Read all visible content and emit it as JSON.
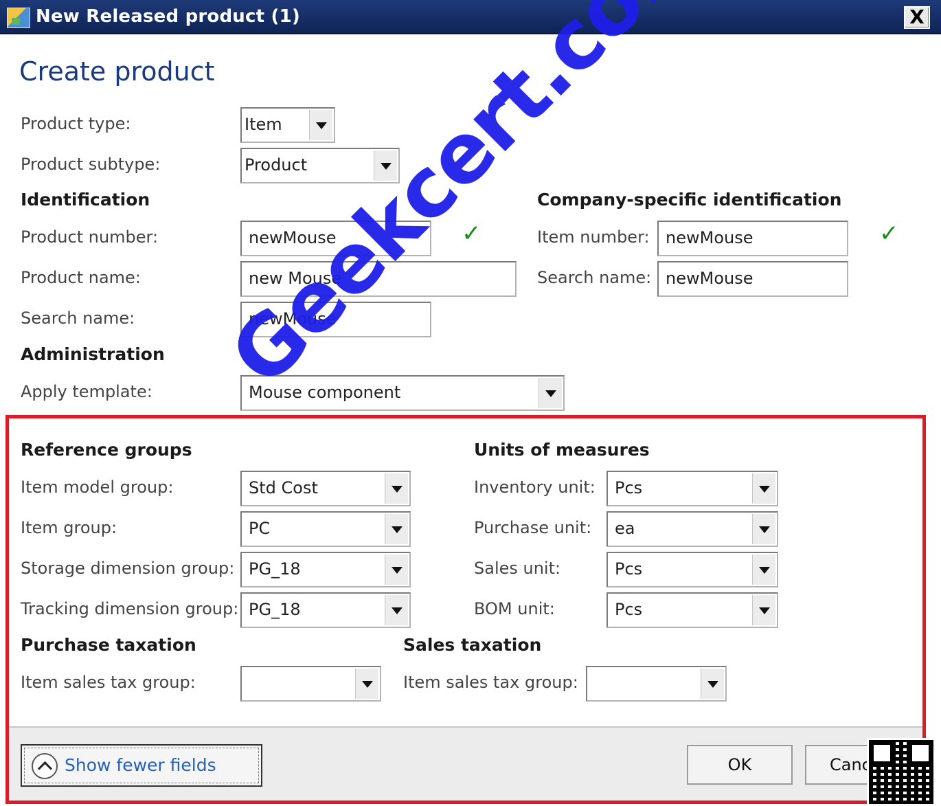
{
  "window": {
    "title": "New Released product (1)",
    "close_label": "X"
  },
  "heading": "Create product",
  "top": {
    "product_type_label": "Product type:",
    "product_type_value": "Item",
    "product_subtype_label": "Product subtype:",
    "product_subtype_value": "Product"
  },
  "identification": {
    "title": "Identification",
    "product_number_label": "Product number:",
    "product_number_value": "newMouse",
    "product_name_label": "Product name:",
    "product_name_value": "new Mouse",
    "search_name_label": "Search name:",
    "search_name_value": "newMouse"
  },
  "company": {
    "title": "Company-specific identification",
    "item_number_label": "Item number:",
    "item_number_value": "newMouse",
    "search_name_label": "Search name:",
    "search_name_value": "newMouse"
  },
  "administration": {
    "title": "Administration",
    "apply_template_label": "Apply template:",
    "apply_template_value": "Mouse component"
  },
  "reference_groups": {
    "title": "Reference groups",
    "rows": [
      {
        "label": "Item model group:",
        "value": "Std Cost"
      },
      {
        "label": "Item group:",
        "value": "PC"
      },
      {
        "label": "Storage dimension group:",
        "value": "PG_18"
      },
      {
        "label": "Tracking dimension group:",
        "value": "PG_18"
      }
    ]
  },
  "units": {
    "title": "Units of measures",
    "rows": [
      {
        "label": "Inventory unit:",
        "value": "Pcs"
      },
      {
        "label": "Purchase unit:",
        "value": "ea"
      },
      {
        "label": "Sales unit:",
        "value": "Pcs"
      },
      {
        "label": "BOM unit:",
        "value": "Pcs"
      }
    ]
  },
  "purchase_taxation": {
    "title": "Purchase taxation",
    "label": "Item sales tax group:",
    "value": ""
  },
  "sales_taxation": {
    "title": "Sales taxation",
    "label": "Item sales tax group:",
    "value": ""
  },
  "footer": {
    "show_fewer": "Show fewer fields",
    "ok": "OK",
    "cancel": "Cancel"
  },
  "watermark": "Geekcert.com",
  "colors": {
    "title_bar": "#0f2456",
    "heading": "#1a3a7a",
    "highlight_border": "#d81c2a",
    "watermark": "#1e1ee8",
    "check": "#1e8a1e"
  }
}
